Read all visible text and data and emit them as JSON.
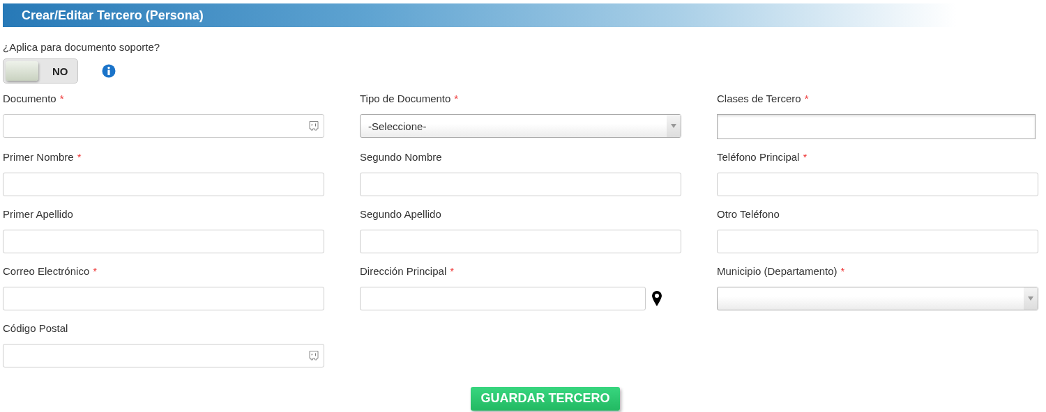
{
  "header": {
    "title": "Crear/Editar Tercero (Persona)"
  },
  "question": {
    "label": "¿Aplica para documento soporte?",
    "toggle": {
      "on": false,
      "label": "NO"
    }
  },
  "fields": [
    {
      "label": "Documento",
      "mark": "*",
      "kind": "keyboard"
    },
    {
      "label": "Tipo de Documento",
      "mark": "*",
      "kind": "select",
      "value": "-Seleccione-"
    },
    {
      "label": "Clases de Tercero",
      "mark": "*",
      "kind": "multi"
    },
    {
      "label": "Primer Nombre",
      "mark": "*",
      "kind": "text"
    },
    {
      "label": "Segundo Nombre",
      "kind": "text"
    },
    {
      "label": "Teléfono Principal",
      "mark": "*",
      "kind": "text"
    },
    {
      "label": "Primer Apellido",
      "kind": "text"
    },
    {
      "label": "Segundo Apellido",
      "kind": "text"
    },
    {
      "label": "Otro Teléfono",
      "kind": "text"
    },
    {
      "label": "Correo Electrónico",
      "mark": "*",
      "kind": "text"
    },
    {
      "label": "Dirección Principal",
      "mark": "*",
      "kind": "address"
    },
    {
      "label": "Municipio (Departamento)",
      "mark": "*",
      "kind": "select"
    },
    {
      "label": "Código Postal",
      "kind": "keyboard"
    }
  ],
  "save_button": "GUARDAR TERCERO"
}
